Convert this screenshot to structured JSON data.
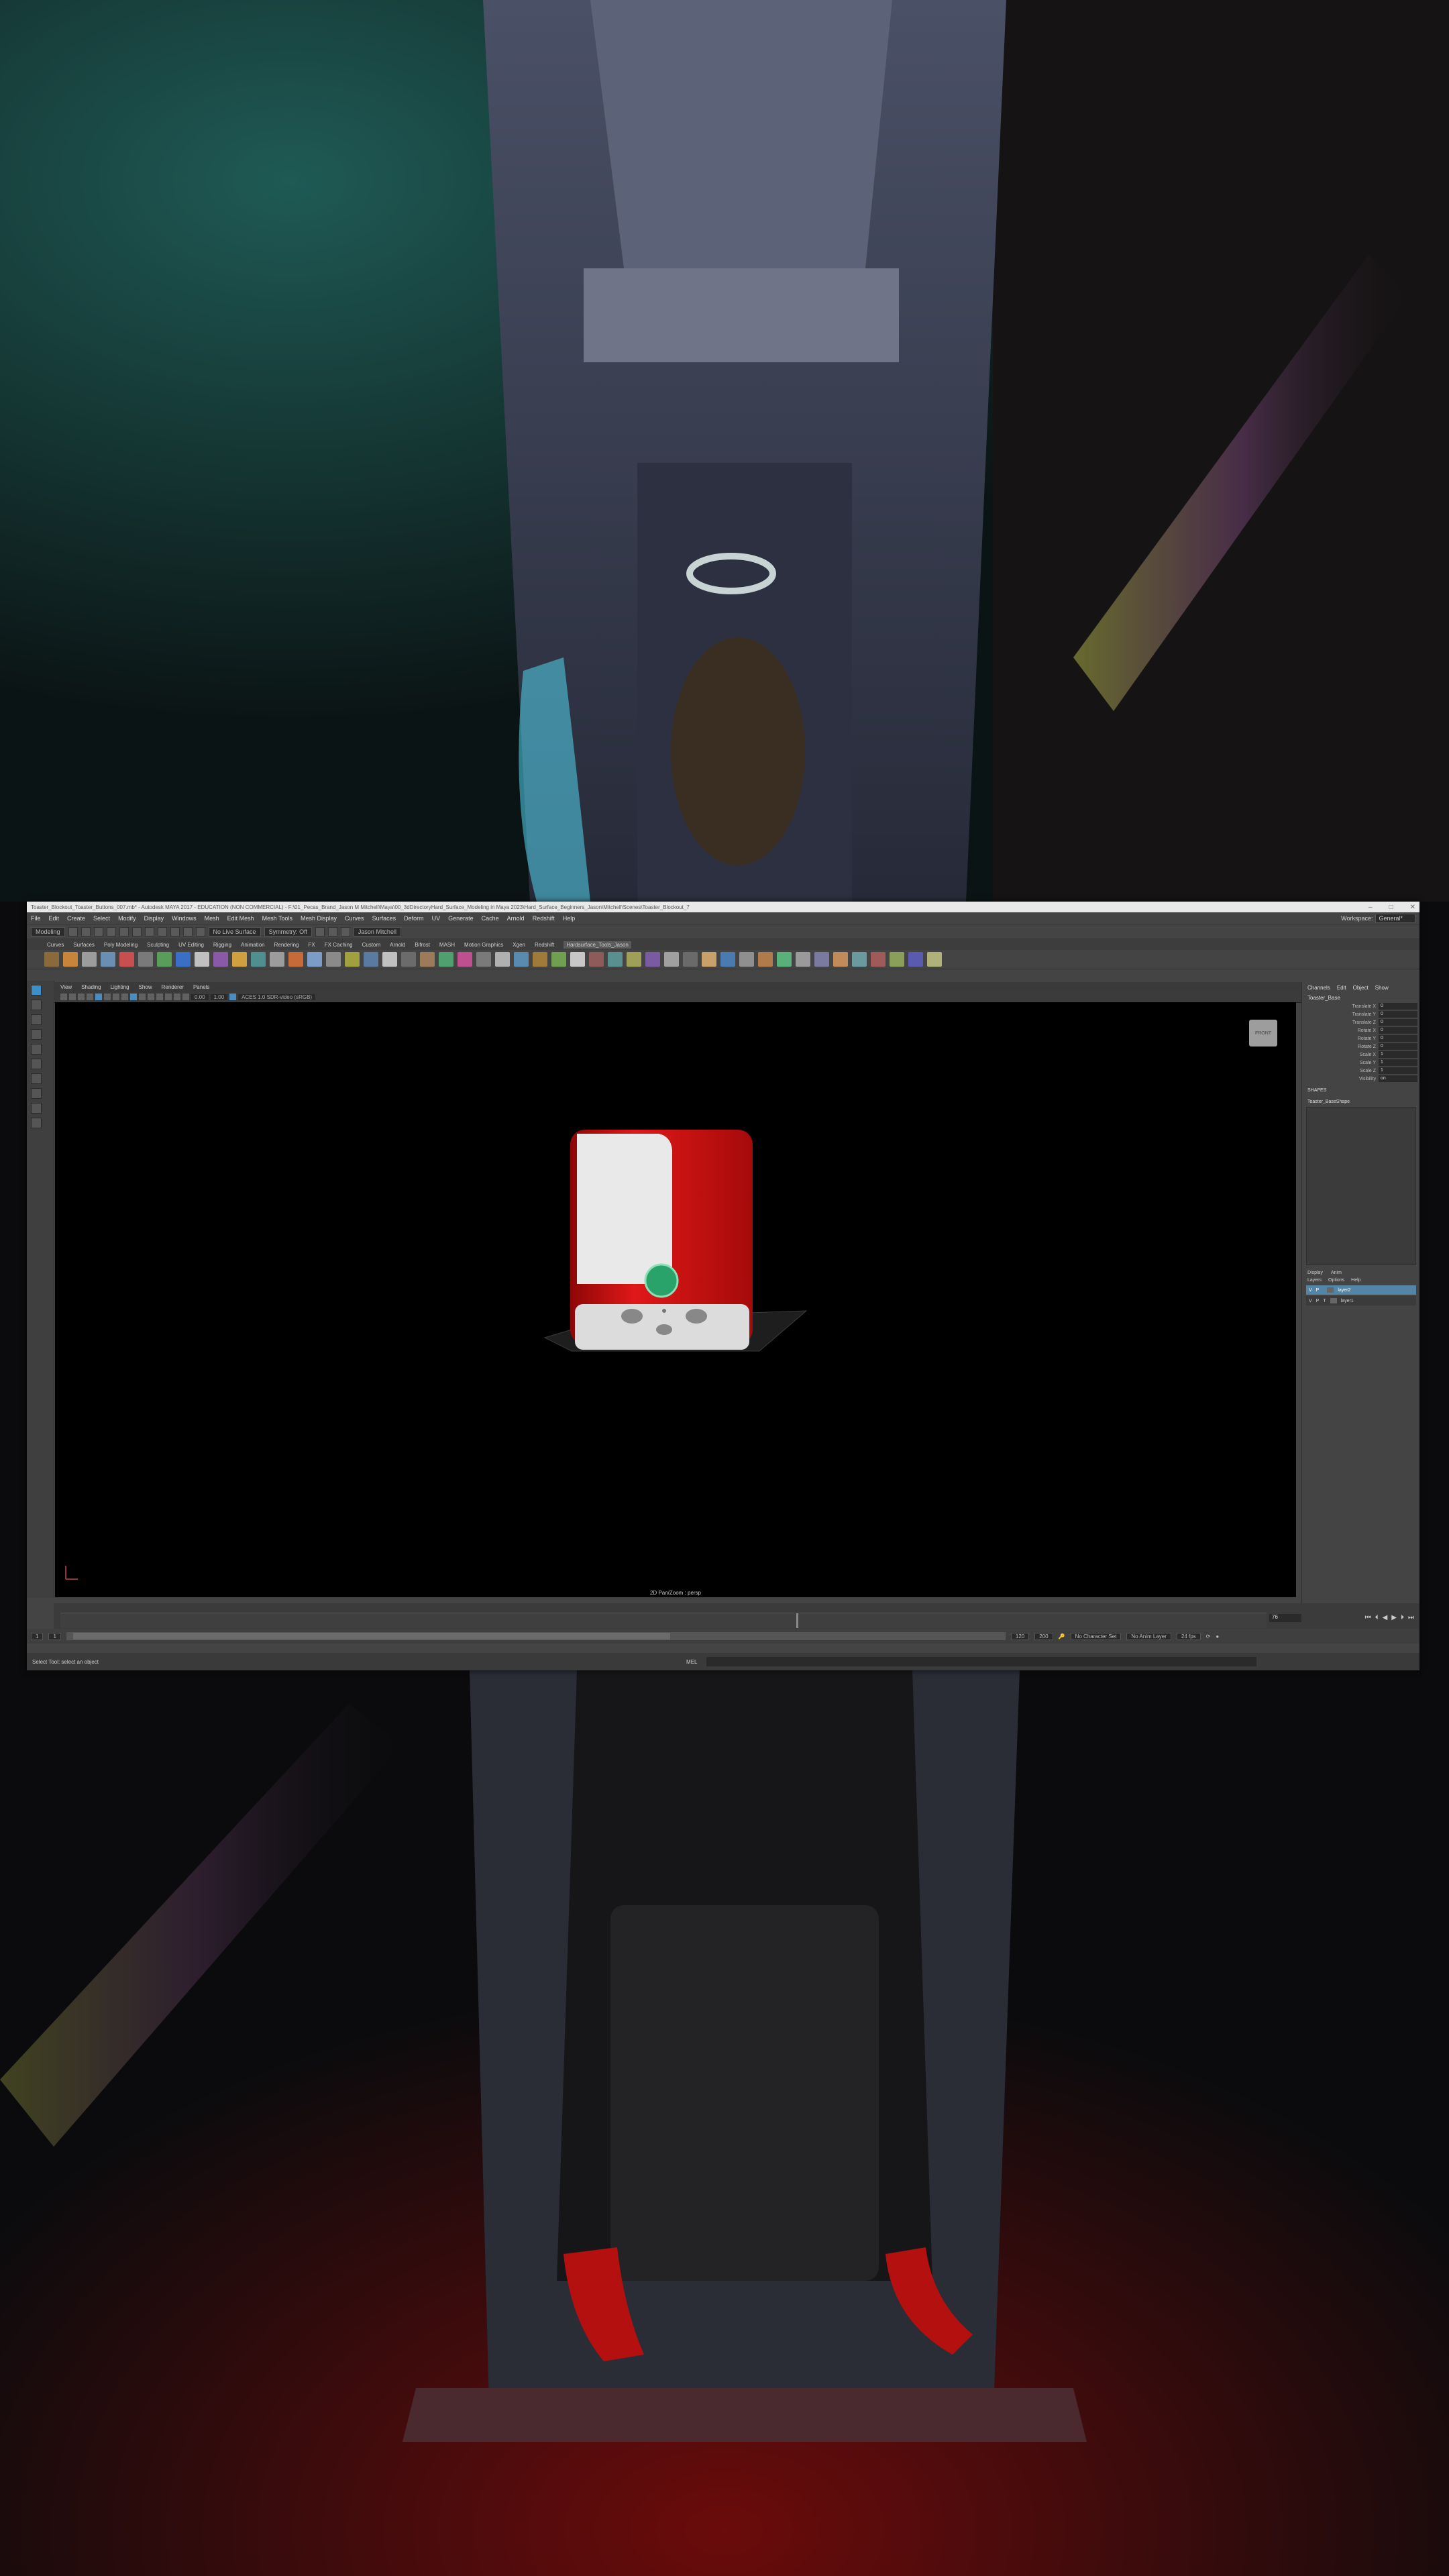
{
  "window": {
    "title": "Toaster_Blockout_Toaster_Buttons_007.mb* - Autodesk MAYA 2017 - EDUCATION (NON COMMERCIAL) - F:\\01_Pecas_Brand_Jason M Mitchell\\Maya\\00_3dDirectoryHard_Surface_Modeling in Maya 2023\\Hard_Surface_Beginners_Jason\\Mitchell\\Scenes\\Toaster_Blockout_7"
  },
  "menus": [
    "File",
    "Edit",
    "Create",
    "Select",
    "Modify",
    "Display",
    "Windows",
    "Mesh",
    "Edit Mesh",
    "Mesh Tools",
    "Mesh Display",
    "Curves",
    "Surfaces",
    "Deform",
    "UV",
    "Generate",
    "Cache",
    "Arnold",
    "Redshift",
    "Help"
  ],
  "workspace": {
    "label": "Workspace:",
    "value": "General*"
  },
  "status_line": {
    "mode": "Modeling",
    "live_surface": "No Live Surface",
    "symmetry": "Symmetry: Off",
    "user": "Jason Mitchell"
  },
  "shelf_tabs": [
    "Curves",
    "Surfaces",
    "Poly Modeling",
    "Sculpting",
    "UV Editing",
    "Rigging",
    "Animation",
    "Rendering",
    "FX",
    "FX Caching",
    "Custom",
    "Arnold",
    "Bifrost",
    "MASH",
    "Motion Graphics",
    "Xgen",
    "Redshift",
    "Hardsurface_Tools_Jason"
  ],
  "shelf_icon_colors": [
    "#8a6a3d",
    "#c7843a",
    "#9c9c9c",
    "#6b8fb3",
    "#c74f4f",
    "#7a7a7a",
    "#5a9c5a",
    "#3a6fc7",
    "#c0c0c0",
    "#8a5aa8",
    "#d0a040",
    "#4f8f8f",
    "#9c9c9c",
    "#c76a3a",
    "#7a9cc7",
    "#8a8a8a",
    "#a0a040",
    "#5a7aa0",
    "#c0c0c0",
    "#6b6b6b",
    "#9c7a5a",
    "#4f9f6f",
    "#c04f8f",
    "#7a7a7a",
    "#b0b0b0",
    "#5a8ab0",
    "#a07a3a",
    "#6f9f4f",
    "#c7c7c7",
    "#8f5a5a",
    "#5a8f8f",
    "#9f9f5a",
    "#7a5aa0",
    "#a0a0a0",
    "#6a6a6a",
    "#c7a06a",
    "#4a7ab0",
    "#8f8f8f",
    "#b07a4a",
    "#5ab07a",
    "#9a9a9a",
    "#7a7aa0",
    "#c08a5a",
    "#6a9aa0",
    "#a05a5a",
    "#8aa05a",
    "#5a5ab0",
    "#b0b07a"
  ],
  "panel_menus": [
    "View",
    "Shading",
    "Lighting",
    "Show",
    "Renderer",
    "Panels"
  ],
  "viewport": {
    "camera_label": "2D Pan/Zoom : persp",
    "view_cube_label": "FRONT",
    "gamma_value": "0.00",
    "exposure_value": "1.00",
    "colorspace": "ACES 1.0 SDR-video (sRGB)"
  },
  "channel_box": {
    "tabs": [
      "Channels",
      "Edit",
      "Object",
      "Show"
    ],
    "object": "Toaster_Base",
    "attributes": [
      {
        "name": "Translate X",
        "value": "0"
      },
      {
        "name": "Translate Y",
        "value": "0"
      },
      {
        "name": "Translate Z",
        "value": "0"
      },
      {
        "name": "Rotate X",
        "value": "0"
      },
      {
        "name": "Rotate Y",
        "value": "0"
      },
      {
        "name": "Rotate Z",
        "value": "0"
      },
      {
        "name": "Scale X",
        "value": "1"
      },
      {
        "name": "Scale Y",
        "value": "1"
      },
      {
        "name": "Scale Z",
        "value": "1"
      },
      {
        "name": "Visibility",
        "value": "on"
      }
    ],
    "shapes_header": "SHAPES",
    "shape_name": "Toaster_BaseShape"
  },
  "layer_editor": {
    "tabs": [
      "Display",
      "Anim"
    ],
    "menus": [
      "Layers",
      "Options",
      "Help"
    ],
    "layers": [
      {
        "v": "V",
        "p": "P",
        "r": "",
        "name": "layer2",
        "selected": true
      },
      {
        "v": "V",
        "p": "P",
        "r": "T",
        "name": "layer1",
        "selected": false
      }
    ]
  },
  "time_slider": {
    "current_frame": "76",
    "progress": 0.61
  },
  "range": {
    "start": "1",
    "start_inner": "1",
    "end_inner": "120",
    "end": "200",
    "character_set": "No Character Set",
    "anim_layer": "No Anim Layer",
    "fps": "24 fps"
  },
  "command_line": {
    "help_text": "Select Tool: select an object",
    "language": "MEL"
  }
}
